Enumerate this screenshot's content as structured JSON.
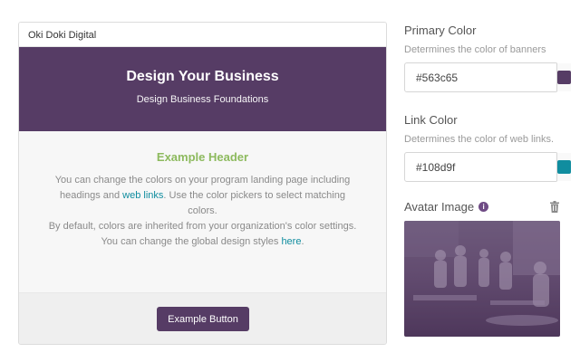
{
  "preview": {
    "org_name": "Oki Doki Digital",
    "banner_title": "Design Your Business",
    "banner_subtitle": "Design Business Foundations",
    "example_header": "Example Header",
    "body_line_1a": "You can change the colors on your program landing page including",
    "body_line_2a": "headings and ",
    "body_link_1": "web links",
    "body_line_2b": ". Use the color pickers to select matching colors.",
    "body_line_3": "By default, colors are inherited from your organization's color settings.",
    "body_line_4a": "You can change the global design styles ",
    "body_link_2": "here",
    "body_line_4b": ".",
    "button_label": "Example Button"
  },
  "settings": {
    "primary_color": {
      "label": "Primary Color",
      "help": "Determines the color of banners",
      "value": "#563c65"
    },
    "link_color": {
      "label": "Link Color",
      "help": "Determines the color of web links.",
      "value": "#108d9f"
    },
    "avatar": {
      "label": "Avatar Image",
      "info_icon": "info-icon",
      "delete_icon": "trash-icon"
    }
  },
  "colors": {
    "primary": "#563c65",
    "link": "#108d9f",
    "header_green": "#8dba5e"
  }
}
